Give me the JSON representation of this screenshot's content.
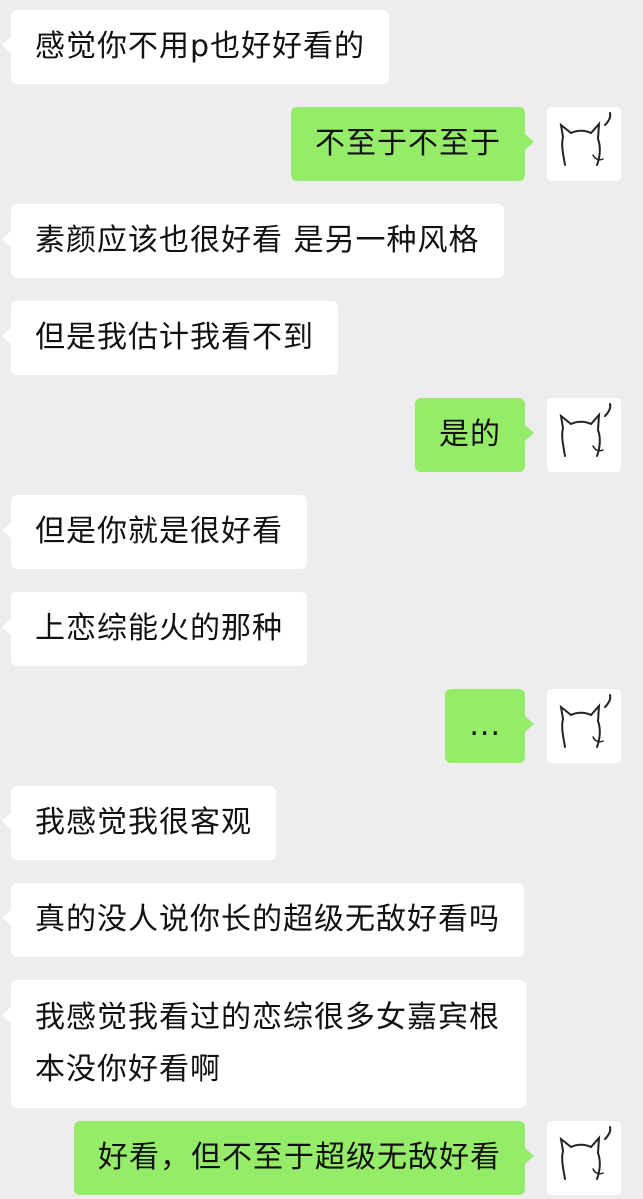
{
  "messages": [
    {
      "side": "in",
      "text": "感觉你不用p也好好看的"
    },
    {
      "side": "out",
      "text": "不至于不至于"
    },
    {
      "side": "in",
      "text": "素颜应该也很好看 是另一种风格"
    },
    {
      "side": "in",
      "text": "但是我估计我看不到"
    },
    {
      "side": "out",
      "text": "是的"
    },
    {
      "side": "in",
      "text": "但是你就是很好看"
    },
    {
      "side": "in",
      "text": "上恋综能火的那种"
    },
    {
      "side": "out",
      "text": "..."
    },
    {
      "side": "in",
      "text": "我感觉我很客观"
    },
    {
      "side": "in",
      "text": "真的没人说你长的超级无敌好看吗"
    },
    {
      "side": "in",
      "text": "我感觉我看过的恋综很多女嘉宾根本没你好看啊"
    },
    {
      "side": "out",
      "text": "好看，但不至于超级无敌好看"
    }
  ],
  "avatar_icon": "cat-sketch-icon",
  "colors": {
    "background": "#ededed",
    "incoming_bubble": "#ffffff",
    "outgoing_bubble": "#95ec69"
  }
}
